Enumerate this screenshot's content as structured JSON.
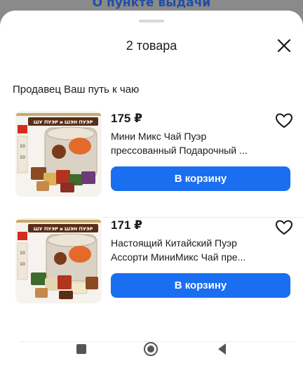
{
  "background": {
    "link_text": "О пункте выдачи"
  },
  "sheet": {
    "title": "2 товара"
  },
  "seller": {
    "label": "Продавец Ваш путь к чаю"
  },
  "products": [
    {
      "price": "175 ₽",
      "name_line1": "Мини Микс Чай Пуэр",
      "name_line2": "прессованный Подарочный ...",
      "button_label": "В корзину",
      "banner_text": "ШУ ПУЭР и ШЭН ПУЭР",
      "tag_text": "10"
    },
    {
      "price": "171 ₽",
      "name_line1": "Настоящий Китайский Пуэр",
      "name_line2": "Ассорти МиниМикс Чай пре...",
      "button_label": "В корзину",
      "banner_text": "ШУ ПУЭР и ШЭН ПУЭР",
      "tag_text": "10"
    }
  ],
  "colors": {
    "accent": "#1a6ef0",
    "text": "#1a1a1a"
  },
  "icons": {
    "close": "close-icon",
    "favorite": "heart-outline-icon",
    "nav": [
      "square-icon",
      "circle-icon",
      "back-triangle-icon"
    ]
  }
}
